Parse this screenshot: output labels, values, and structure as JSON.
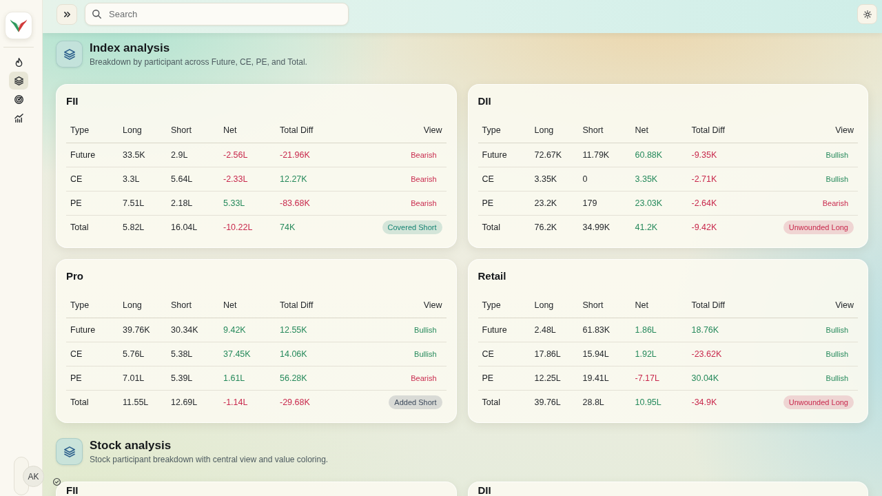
{
  "sidebar": {
    "items": [
      {
        "selected": false
      },
      {
        "selected": true
      },
      {
        "selected": false
      },
      {
        "selected": false
      }
    ],
    "user": {
      "initials": "AK"
    }
  },
  "topbar": {
    "search": {
      "placeholder": "Search"
    }
  },
  "sections": [
    {
      "title": "Index analysis",
      "subtitle": "Breakdown by participant across Future, CE, PE, and Total.",
      "cards": [
        {
          "title": "FII",
          "columns": [
            "Type",
            "Long",
            "Short",
            "Net",
            "Total Diff",
            "View"
          ],
          "rows": [
            {
              "type": "Future",
              "long": "33.5K",
              "short": "2.9L",
              "net": {
                "text": "-2.56L",
                "color": "#c8284c"
              },
              "total_diff": {
                "text": "-21.96K",
                "color": "#c8284c"
              },
              "view": {
                "text": "Bearish",
                "kind": "plain",
                "color": "#c8284c"
              }
            },
            {
              "type": "CE",
              "long": "3.3L",
              "short": "5.64L",
              "net": {
                "text": "-2.33L",
                "color": "#c8284c"
              },
              "total_diff": {
                "text": "12.27K",
                "color": "#25895b"
              },
              "view": {
                "text": "Bearish",
                "kind": "plain",
                "color": "#c8284c"
              }
            },
            {
              "type": "PE",
              "long": "7.51L",
              "short": "2.18L",
              "net": {
                "text": "5.33L",
                "color": "#25895b"
              },
              "total_diff": {
                "text": "-83.68K",
                "color": "#c8284c"
              },
              "view": {
                "text": "Bearish",
                "kind": "plain",
                "color": "#c8284c"
              }
            },
            {
              "type": "Total",
              "long": "5.82L",
              "short": "16.04L",
              "net": {
                "text": "-10.22L",
                "color": "#c8284c"
              },
              "total_diff": {
                "text": "74K",
                "color": "#25895b"
              },
              "view": {
                "text": "Covered Short",
                "kind": "pill",
                "color": "#168473"
              }
            }
          ]
        },
        {
          "title": "DII",
          "columns": [
            "Type",
            "Long",
            "Short",
            "Net",
            "Total Diff",
            "View"
          ],
          "rows": [
            {
              "type": "Future",
              "long": "72.67K",
              "short": "11.79K",
              "net": {
                "text": "60.88K",
                "color": "#25895b"
              },
              "total_diff": {
                "text": "-9.35K",
                "color": "#c8284c"
              },
              "view": {
                "text": "Bullish",
                "kind": "plain",
                "color": "#25895b"
              }
            },
            {
              "type": "CE",
              "long": "3.35K",
              "short": "0",
              "net": {
                "text": "3.35K",
                "color": "#25895b"
              },
              "total_diff": {
                "text": "-2.71K",
                "color": "#c8284c"
              },
              "view": {
                "text": "Bullish",
                "kind": "plain",
                "color": "#25895b"
              }
            },
            {
              "type": "PE",
              "long": "23.2K",
              "short": "179",
              "net": {
                "text": "23.03K",
                "color": "#25895b"
              },
              "total_diff": {
                "text": "-2.64K",
                "color": "#c8284c"
              },
              "view": {
                "text": "Bearish",
                "kind": "plain",
                "color": "#c8284c"
              }
            },
            {
              "type": "Total",
              "long": "76.2K",
              "short": "34.99K",
              "net": {
                "text": "41.2K",
                "color": "#25895b"
              },
              "total_diff": {
                "text": "-9.42K",
                "color": "#c8284c"
              },
              "view": {
                "text": "Unwounded Long",
                "kind": "pill",
                "color": "#c8284c"
              }
            }
          ]
        },
        {
          "title": "Pro",
          "columns": [
            "Type",
            "Long",
            "Short",
            "Net",
            "Total Diff",
            "View"
          ],
          "rows": [
            {
              "type": "Future",
              "long": "39.76K",
              "short": "30.34K",
              "net": {
                "text": "9.42K",
                "color": "#25895b"
              },
              "total_diff": {
                "text": "12.55K",
                "color": "#25895b"
              },
              "view": {
                "text": "Bullish",
                "kind": "plain",
                "color": "#25895b"
              }
            },
            {
              "type": "CE",
              "long": "5.76L",
              "short": "5.38L",
              "net": {
                "text": "37.45K",
                "color": "#25895b"
              },
              "total_diff": {
                "text": "14.06K",
                "color": "#25895b"
              },
              "view": {
                "text": "Bullish",
                "kind": "plain",
                "color": "#25895b"
              }
            },
            {
              "type": "PE",
              "long": "7.01L",
              "short": "5.39L",
              "net": {
                "text": "1.61L",
                "color": "#25895b"
              },
              "total_diff": {
                "text": "56.28K",
                "color": "#25895b"
              },
              "view": {
                "text": "Bearish",
                "kind": "plain",
                "color": "#c8284c"
              }
            },
            {
              "type": "Total",
              "long": "11.55L",
              "short": "12.69L",
              "net": {
                "text": "-1.14L",
                "color": "#c8284c"
              },
              "total_diff": {
                "text": "-29.68K",
                "color": "#c8284c"
              },
              "view": {
                "text": "Added Short",
                "kind": "pill",
                "color": "#3d4a5c"
              }
            }
          ]
        },
        {
          "title": "Retail",
          "columns": [
            "Type",
            "Long",
            "Short",
            "Net",
            "Total Diff",
            "View"
          ],
          "rows": [
            {
              "type": "Future",
              "long": "2.48L",
              "short": "61.83K",
              "net": {
                "text": "1.86L",
                "color": "#25895b"
              },
              "total_diff": {
                "text": "18.76K",
                "color": "#25895b"
              },
              "view": {
                "text": "Bullish",
                "kind": "plain",
                "color": "#25895b"
              }
            },
            {
              "type": "CE",
              "long": "17.86L",
              "short": "15.94L",
              "net": {
                "text": "1.92L",
                "color": "#25895b"
              },
              "total_diff": {
                "text": "-23.62K",
                "color": "#c8284c"
              },
              "view": {
                "text": "Bullish",
                "kind": "plain",
                "color": "#25895b"
              }
            },
            {
              "type": "PE",
              "long": "12.25L",
              "short": "19.41L",
              "net": {
                "text": "-7.17L",
                "color": "#c8284c"
              },
              "total_diff": {
                "text": "30.04K",
                "color": "#25895b"
              },
              "view": {
                "text": "Bullish",
                "kind": "plain",
                "color": "#25895b"
              }
            },
            {
              "type": "Total",
              "long": "39.76L",
              "short": "28.8L",
              "net": {
                "text": "10.95L",
                "color": "#25895b"
              },
              "total_diff": {
                "text": "-34.9K",
                "color": "#c8284c"
              },
              "view": {
                "text": "Unwounded Long",
                "kind": "pill",
                "color": "#c8284c"
              }
            }
          ]
        }
      ]
    },
    {
      "title": "Stock analysis",
      "subtitle": "Stock participant breakdown with central view and value coloring.",
      "cards": [
        {
          "title": "FII"
        },
        {
          "title": "DII"
        }
      ]
    }
  ]
}
